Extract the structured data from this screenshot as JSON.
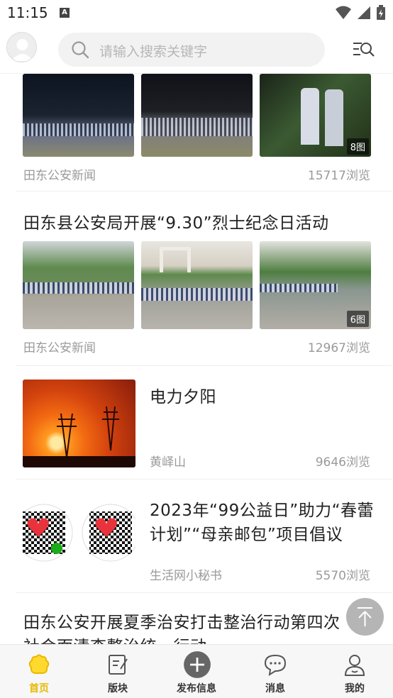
{
  "status_bar": {
    "time": "11:15",
    "badge": "A"
  },
  "header": {
    "search_placeholder": "请输入搜索关键字"
  },
  "feed": {
    "items": [
      {
        "source": "田东公安新闻",
        "views": "15717浏览",
        "badge": "8图"
      },
      {
        "title": "田东县公安局开展“9.30”烈士纪念日活动",
        "source": "田东公安新闻",
        "views": "12967浏览",
        "badge": "6图"
      },
      {
        "title": "电力夕阳",
        "source": "黄峄山",
        "views": "9646浏览"
      },
      {
        "title_line1": "2023年“99公益日”助力“春蕾",
        "title_line2": "计划”“母亲邮包”项目倡议",
        "source": "生活网小秘书",
        "views": "5570浏览"
      },
      {
        "title_line1": "田东公安开展夏季治安打击整治行动第四次",
        "title_line2": "社会面清查整治统一行动"
      }
    ]
  },
  "tabbar": {
    "tabs": [
      {
        "label": "首页",
        "icon": "home-icon",
        "active": true
      },
      {
        "label": "版块",
        "icon": "board-icon"
      },
      {
        "label": "发布信息",
        "icon": "publish-icon"
      },
      {
        "label": "消息",
        "icon": "message-icon"
      },
      {
        "label": "我的",
        "icon": "profile-icon"
      }
    ]
  },
  "colors": {
    "accent": "#e9b800",
    "text": "#222222",
    "muted": "#9a9a9a"
  }
}
